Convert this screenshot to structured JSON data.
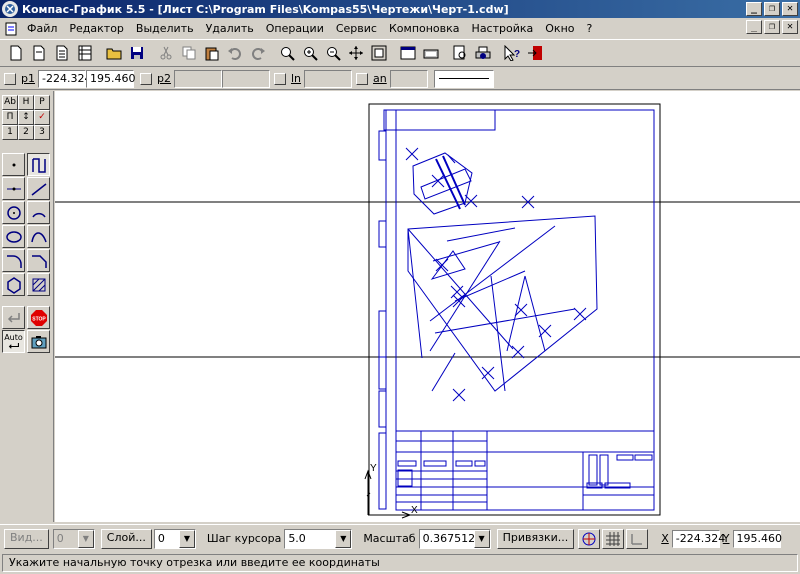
{
  "window": {
    "title": "Компас-График 5.5 - [Лист C:\\Program Files\\Kompas55\\Чертежи\\Черт-1.cdw]",
    "minimize": "_",
    "restore": "❐",
    "close": "✕"
  },
  "menu": {
    "items": [
      "Файл",
      "Редактор",
      "Выделить",
      "Удалить",
      "Операции",
      "Сервис",
      "Компоновка",
      "Настройка",
      "Окно",
      "?"
    ]
  },
  "toolbar": {
    "icons": [
      "new-sheet-icon",
      "new-fragment-icon",
      "new-text-doc-icon",
      "new-spec-icon",
      "open-icon",
      "save-icon",
      "cut-icon",
      "copy-icon",
      "paste-icon",
      "undo-icon",
      "redo-icon",
      "zoom-window-icon",
      "zoom-in-icon",
      "zoom-out-icon",
      "pan-icon",
      "zoom-fit-icon",
      "refresh-icon",
      "layers-icon",
      "preview-icon",
      "print-icon",
      "help-icon",
      "exit-icon"
    ]
  },
  "props": {
    "p1_label": "p1",
    "p1_x": "-224.324",
    "p1_y": "195.460",
    "p2_label": "p2",
    "ln_label": "ln",
    "an_label": "an"
  },
  "leftpanel": {
    "row1": [
      "Ab",
      "H",
      "P"
    ],
    "row2": [
      "П",
      "↕",
      "✓"
    ],
    "row3": [
      "1",
      "2",
      "3"
    ],
    "auto_label": "Auto",
    "stop_label": "STOP"
  },
  "status": {
    "view_button": "Вид...",
    "view_value": "0",
    "layer_button": "Слой...",
    "layer_value": "0",
    "step_label": "Шаг курсора",
    "step_value": "5.0",
    "scale_label": "Масштаб",
    "scale_value": "0.367512",
    "snap_button": "Привязки...",
    "x_label": "X",
    "x_value": "-224.324",
    "y_label": "Y",
    "y_value": "195.460"
  },
  "hint": "Укажите начальную точку отрезка или введите ее координаты",
  "colors": {
    "titlebar_start": "#0a246a",
    "titlebar_end": "#3a6ea5",
    "drawing": "#0000c0",
    "face": "#d4d0c8"
  }
}
